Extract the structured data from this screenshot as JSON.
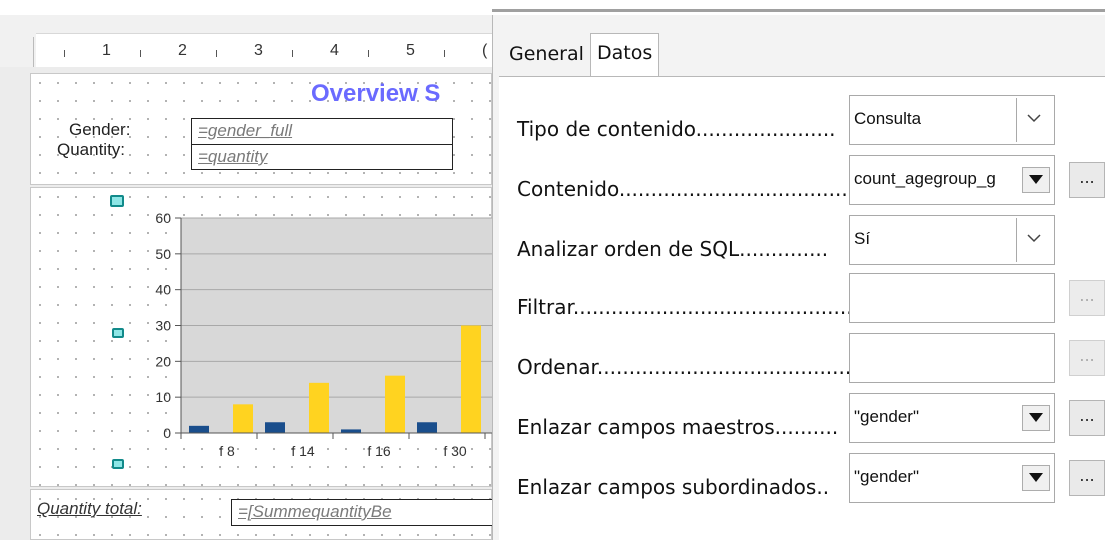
{
  "report": {
    "title": "Overview S",
    "gender_label": "Gender:",
    "gender_field": "=gender_full",
    "quantity_label": "Quantity:",
    "quantity_field": "=quantity",
    "total_label": "Quantity total:",
    "total_field": "=[SummequantityBe"
  },
  "ruler": {
    "numbers": [
      "1",
      "2",
      "3",
      "4",
      "5",
      "("
    ]
  },
  "chart_data": {
    "type": "bar",
    "categories": [
      "f 8",
      "f 14",
      "f 16",
      "f 30"
    ],
    "series": [
      {
        "values": [
          2,
          3,
          1,
          3
        ],
        "color": "#1a4e8c"
      },
      {
        "values": [
          8,
          14,
          16,
          30
        ],
        "color": "#ffd320"
      }
    ],
    "ylim": [
      0,
      60
    ],
    "yticks": [
      "0",
      "10",
      "20",
      "30",
      "40",
      "50",
      "60"
    ],
    "grid": true
  },
  "tabs": {
    "general": "General",
    "datos": "Datos"
  },
  "properties": {
    "tipo": {
      "label": "Tipo de contenido......................",
      "value": "Consulta"
    },
    "contenido": {
      "label": "Contenido....................................",
      "value": "count_agegroup_g"
    },
    "analizar": {
      "label": "Analizar orden de SQL..............",
      "value": "Sí"
    },
    "filtrar": {
      "label": "Filtrar.............................................",
      "value": ""
    },
    "ordenar": {
      "label": "Ordenar.........................................",
      "value": ""
    },
    "maestros": {
      "label": "Enlazar campos maestros..........",
      "value": "\"gender\""
    },
    "subordinados": {
      "label": "Enlazar campos subordinados..",
      "value": "\"gender\""
    },
    "ellipsis": "..."
  },
  "icons": {
    "dropdown_combo": "chevron-down-icon",
    "dropdown_list": "triangle-down-icon"
  }
}
